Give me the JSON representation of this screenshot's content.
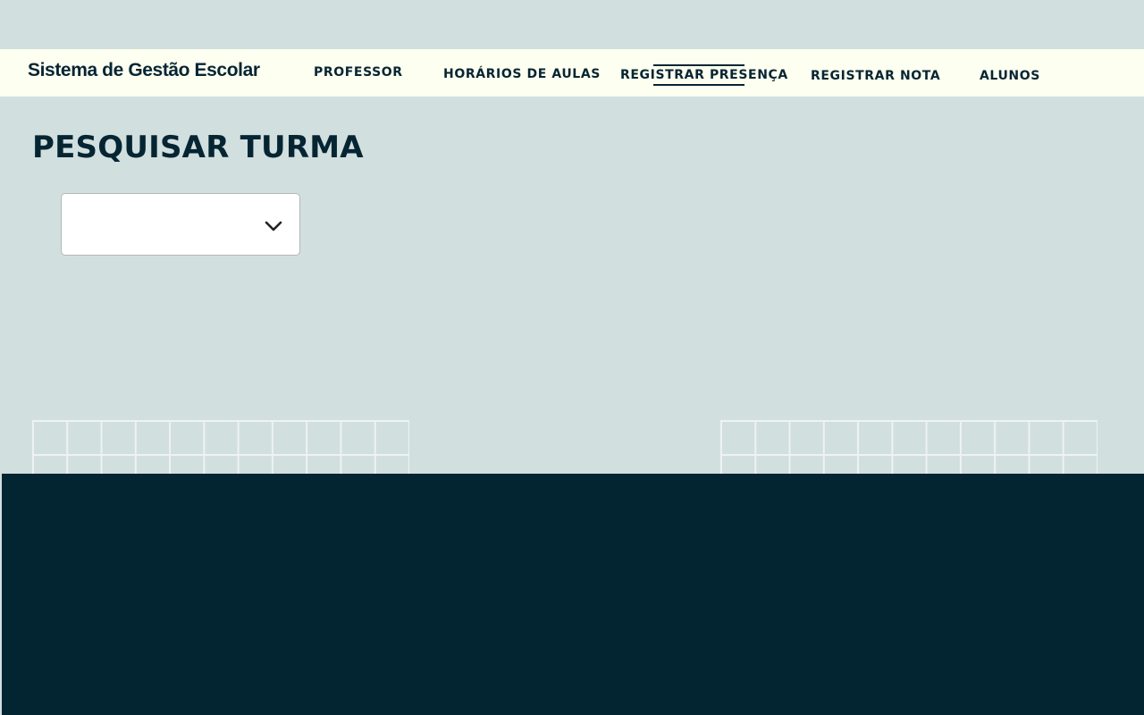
{
  "header": {
    "brand": "Sistema de Gestão Escolar",
    "nav": [
      {
        "label": "PROFESSOR"
      },
      {
        "label": "HORÁRIOS DE AULAS"
      },
      {
        "label": "REGISTRAR PRESENÇA",
        "active": true
      },
      {
        "label": "REGISTRAR NOTA"
      },
      {
        "label": "ALUNOS"
      }
    ]
  },
  "main": {
    "title": "PESQUISAR TURMA",
    "turma_select": {
      "value": "",
      "icon": "chevron-down-icon"
    }
  },
  "colors": {
    "background": "#d2dfdf",
    "navbar": "#fdfff0",
    "text": "#062533",
    "footer": "#032532"
  }
}
